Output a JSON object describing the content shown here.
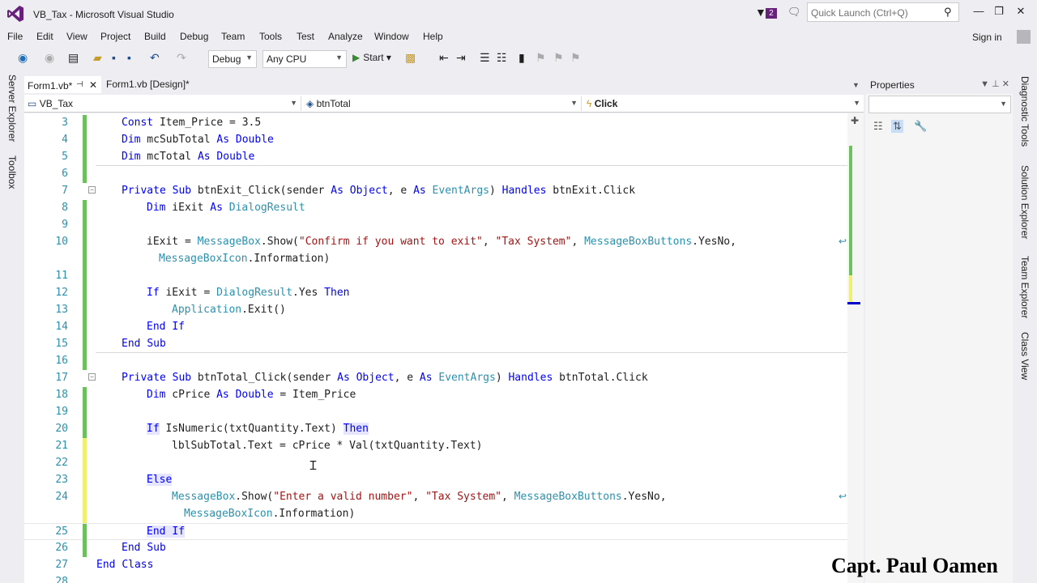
{
  "window": {
    "title": "VB_Tax - Microsoft Visual Studio",
    "notification_count": "2",
    "quick_launch_placeholder": "Quick Launch (Ctrl+Q)",
    "sign_in": "Sign in"
  },
  "menu": [
    "File",
    "Edit",
    "View",
    "Project",
    "Build",
    "Debug",
    "Team",
    "Tools",
    "Test",
    "Analyze",
    "Window",
    "Help"
  ],
  "toolbar": {
    "config": "Debug",
    "platform": "Any CPU",
    "start": "Start"
  },
  "left_rail": [
    "Server Explorer",
    "Toolbox"
  ],
  "right_rail": [
    "Diagnostic Tools",
    "Solution Explorer",
    "Team Explorer",
    "Class View"
  ],
  "doc_tabs": [
    {
      "label": "Form1.vb*",
      "active": true
    },
    {
      "label": "Form1.vb [Design]*",
      "active": false
    }
  ],
  "nav": {
    "project": "VB_Tax",
    "object": "btnTotal",
    "event": "Click"
  },
  "properties": {
    "title": "Properties"
  },
  "code_lines": [
    {
      "n": "3"
    },
    {
      "n": "4"
    },
    {
      "n": "5"
    },
    {
      "n": "6"
    },
    {
      "n": "7"
    },
    {
      "n": "8"
    },
    {
      "n": "9"
    },
    {
      "n": "10"
    },
    {
      "n": ""
    },
    {
      "n": "11"
    },
    {
      "n": "12"
    },
    {
      "n": "13"
    },
    {
      "n": "14"
    },
    {
      "n": "15"
    },
    {
      "n": "16"
    },
    {
      "n": "17"
    },
    {
      "n": "18"
    },
    {
      "n": "19"
    },
    {
      "n": "20"
    },
    {
      "n": "21"
    },
    {
      "n": "22"
    },
    {
      "n": "23"
    },
    {
      "n": "24"
    },
    {
      "n": ""
    },
    {
      "n": "25"
    },
    {
      "n": "26"
    },
    {
      "n": "27"
    },
    {
      "n": "28"
    }
  ],
  "code": {
    "l3": [
      "Const",
      " Item_Price = 3.5"
    ],
    "l4": [
      "Dim",
      " mcSubTotal ",
      "As",
      " ",
      "Double"
    ],
    "l5": [
      "Dim",
      " mcTotal ",
      "As",
      " ",
      "Double"
    ],
    "l7": [
      "Private",
      " ",
      "Sub",
      " btnExit_Click(sender ",
      "As",
      " ",
      "Object",
      ", e ",
      "As",
      " ",
      "EventArgs",
      ") ",
      "Handles",
      " btnExit.Click"
    ],
    "l8": [
      "Dim",
      " iExit ",
      "As",
      " ",
      "DialogResult"
    ],
    "l10": [
      "iExit = ",
      "MessageBox",
      ".Show(",
      "\"Confirm if you want to exit\"",
      ", ",
      "\"Tax System\"",
      ", ",
      "MessageBoxButtons",
      ".YesNo,"
    ],
    "l10b": [
      "MessageBoxIcon",
      ".Information)"
    ],
    "l12": [
      "If",
      " iExit = ",
      "DialogResult",
      ".Yes ",
      "Then"
    ],
    "l13": [
      "Application",
      ".Exit()"
    ],
    "l14": [
      "End",
      " ",
      "If"
    ],
    "l15": [
      "End",
      " ",
      "Sub"
    ],
    "l17": [
      "Private",
      " ",
      "Sub",
      " btnTotal_Click(sender ",
      "As",
      " ",
      "Object",
      ", e ",
      "As",
      " ",
      "EventArgs",
      ") ",
      "Handles",
      " btnTotal.Click"
    ],
    "l18": [
      "Dim",
      " cPrice ",
      "As",
      " ",
      "Double",
      " = Item_Price"
    ],
    "l20": [
      "If",
      " IsNumeric(txtQuantity.Text) ",
      "Then"
    ],
    "l21": [
      "lblSubTotal.Text = cPrice * Val(txtQuantity.Text)"
    ],
    "l23": [
      "Else"
    ],
    "l24": [
      "MessageBox",
      ".Show(",
      "\"Enter a valid number\"",
      ", ",
      "\"Tax System\"",
      ", ",
      "MessageBoxButtons",
      ".YesNo,"
    ],
    "l24b": [
      "MessageBoxIcon",
      ".Information)"
    ],
    "l25": [
      "End",
      " ",
      "If"
    ],
    "l26": [
      "End",
      " ",
      "Sub"
    ],
    "l27": [
      "End",
      " ",
      "Class"
    ]
  },
  "watermark": "Capt. Paul Oamen",
  "colors": {
    "keyword": "#0000ff",
    "type": "#2b91af",
    "string": "#a31515",
    "change_saved": "#6dc05e",
    "change_unsaved": "#efef73"
  }
}
